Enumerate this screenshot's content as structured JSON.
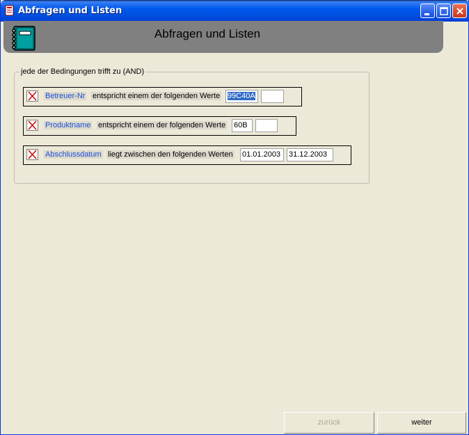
{
  "window": {
    "title": "Abfragen und Listen"
  },
  "header": {
    "title": "Abfragen und Listen",
    "icon": "notebook-icon"
  },
  "group": {
    "label": "jede der Bedingungen trifft zu (AND)"
  },
  "conditions": [
    {
      "field": "Betreuer-Nr",
      "operator": "entspricht einem der folgenden Werte",
      "values": [
        "99C40A",
        ""
      ],
      "selected_value_index": 0
    },
    {
      "field": "Produktname",
      "operator": "entspricht einem der folgenden Werte",
      "values": [
        "60B",
        ""
      ]
    },
    {
      "field": "Abschlussdatum",
      "operator": "liegt zwischen den folgenden Werten",
      "values": [
        "01.01.2003",
        "31.12.2003"
      ]
    }
  ],
  "buttons": {
    "back_label": "zurück",
    "back_enabled": false,
    "next_label": "weiter"
  },
  "colors": {
    "field_link": "#1c50d8",
    "header_band": "#808080",
    "titlebar": "#0058ee",
    "selection": "#316ac5"
  }
}
